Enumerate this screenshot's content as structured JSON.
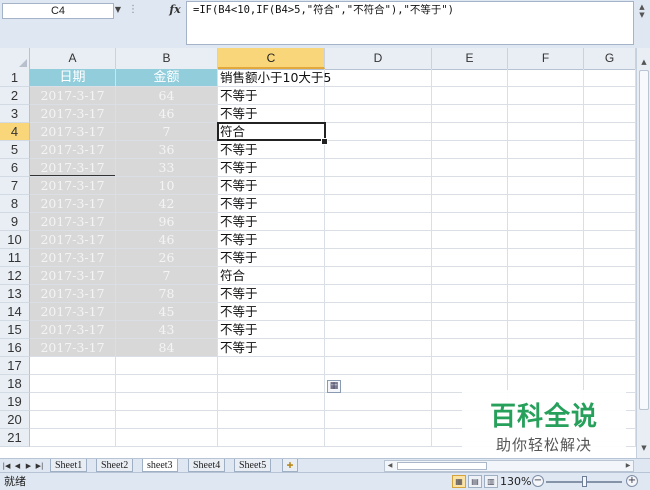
{
  "formula_bar": {
    "name_box": "C4",
    "fx_label": "fx",
    "formula": "=IF(B4<10,IF(B4>5,\"符合\",\"不符合\"),\"不等于\")"
  },
  "columns": [
    "A",
    "B",
    "C",
    "D",
    "E",
    "F",
    "G"
  ],
  "active_column": "C",
  "active_row": 4,
  "row_numbers": [
    "1",
    "2",
    "3",
    "4",
    "5",
    "6",
    "7",
    "8",
    "9",
    "10",
    "11",
    "12",
    "13",
    "14",
    "15",
    "16",
    "17",
    "18",
    "19",
    "20",
    "21"
  ],
  "table": {
    "header_date": "日期",
    "header_amount": "金额",
    "c1_title": "销售额小于10大于5",
    "rows": [
      {
        "date": "2017-3-17",
        "amount": "64",
        "result": "不等于"
      },
      {
        "date": "2017-3-17",
        "amount": "46",
        "result": "不等于"
      },
      {
        "date": "2017-3-17",
        "amount": "7",
        "result": "符合"
      },
      {
        "date": "2017-3-17",
        "amount": "36",
        "result": "不等于"
      },
      {
        "date": "2017-3-17",
        "amount": "33",
        "result": "不等于"
      },
      {
        "date": "2017-3-17",
        "amount": "10",
        "result": "不等于"
      },
      {
        "date": "2017-3-17",
        "amount": "42",
        "result": "不等于"
      },
      {
        "date": "2017-3-17",
        "amount": "96",
        "result": "不等于"
      },
      {
        "date": "2017-3-17",
        "amount": "46",
        "result": "不等于"
      },
      {
        "date": "2017-3-17",
        "amount": "26",
        "result": "不等于"
      },
      {
        "date": "2017-3-17",
        "amount": "7",
        "result": "符合"
      },
      {
        "date": "2017-3-17",
        "amount": "78",
        "result": "不等于"
      },
      {
        "date": "2017-3-17",
        "amount": "45",
        "result": "不等于"
      },
      {
        "date": "2017-3-17",
        "amount": "43",
        "result": "不等于"
      },
      {
        "date": "2017-3-17",
        "amount": "84",
        "result": "不等于"
      }
    ]
  },
  "sheet_tabs": [
    "Sheet1",
    "Sheet2",
    "sheet3",
    "Sheet4",
    "Sheet5"
  ],
  "active_sheet": "sheet3",
  "status": {
    "ready": "就绪",
    "zoom": "130%"
  },
  "watermark": {
    "title": "百科全说",
    "subtitle": "助你轻松解决"
  },
  "colors": {
    "header_fill": "#92cddc",
    "data_fill": "#d8d8d8",
    "active_header": "#f9d67a",
    "watermark_green": "#27a05b"
  }
}
